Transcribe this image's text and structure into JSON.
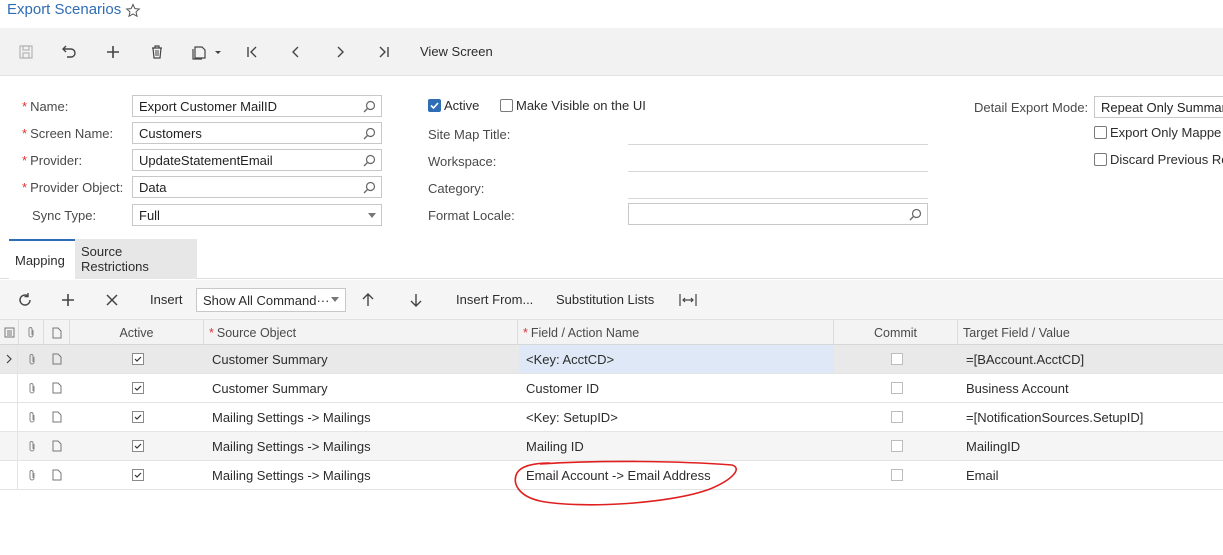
{
  "header": {
    "title": "Export Scenarios"
  },
  "toolbar": {
    "view_screen": "View Screen"
  },
  "form": {
    "name": {
      "label": "Name:",
      "value": "Export Customer MailID"
    },
    "screen_name": {
      "label": "Screen Name:",
      "value": "Customers"
    },
    "provider": {
      "label": "Provider:",
      "value": "UpdateStatementEmail"
    },
    "provider_object": {
      "label": "Provider Object:",
      "value": "Data"
    },
    "sync_type": {
      "label": "Sync Type:",
      "value": "Full"
    },
    "active": {
      "label": "Active",
      "checked": true
    },
    "visible_ui": {
      "label": "Make Visible on the UI",
      "checked": false
    },
    "site_map_title": {
      "label": "Site Map Title:"
    },
    "workspace": {
      "label": "Workspace:"
    },
    "category": {
      "label": "Category:"
    },
    "format_locale": {
      "label": "Format Locale:"
    },
    "detail_export_mode": {
      "label": "Detail Export Mode:",
      "value": "Repeat Only Summar"
    },
    "export_only_mapped": {
      "label": "Export Only Mappe",
      "checked": false
    },
    "discard_previous": {
      "label": "Discard Previous Re",
      "checked": false
    }
  },
  "tabs": [
    {
      "label": "Mapping"
    },
    {
      "label": "Source Restrictions"
    }
  ],
  "grid_toolbar": {
    "insert": "Insert",
    "combo": "Show All Command···",
    "insert_from": "Insert From...",
    "substitution_lists": "Substitution Lists"
  },
  "columns": {
    "active": "Active",
    "source_object": "Source Object",
    "field_action": "Field / Action Name",
    "commit": "Commit",
    "target": "Target Field / Value"
  },
  "rows": [
    {
      "active": true,
      "source": "Customer Summary",
      "field": "<Key: AcctCD>",
      "commit": false,
      "target": "=[BAccount.AcctCD]"
    },
    {
      "active": true,
      "source": "Customer Summary",
      "field": "Customer ID",
      "commit": false,
      "target": "Business Account"
    },
    {
      "active": true,
      "source": "Mailing Settings -> Mailings",
      "field": "<Key: SetupID>",
      "commit": false,
      "target": "=[NotificationSources.SetupID]"
    },
    {
      "active": true,
      "source": "Mailing Settings -> Mailings",
      "field": "Mailing ID",
      "commit": false,
      "target": "MailingID"
    },
    {
      "active": true,
      "source": "Mailing Settings -> Mailings",
      "field": "Email Account -> Email Address",
      "commit": false,
      "target": "Email"
    }
  ],
  "colors": {
    "accent": "#2f6db5",
    "annotation": "#e02020",
    "required": "#d33333"
  }
}
